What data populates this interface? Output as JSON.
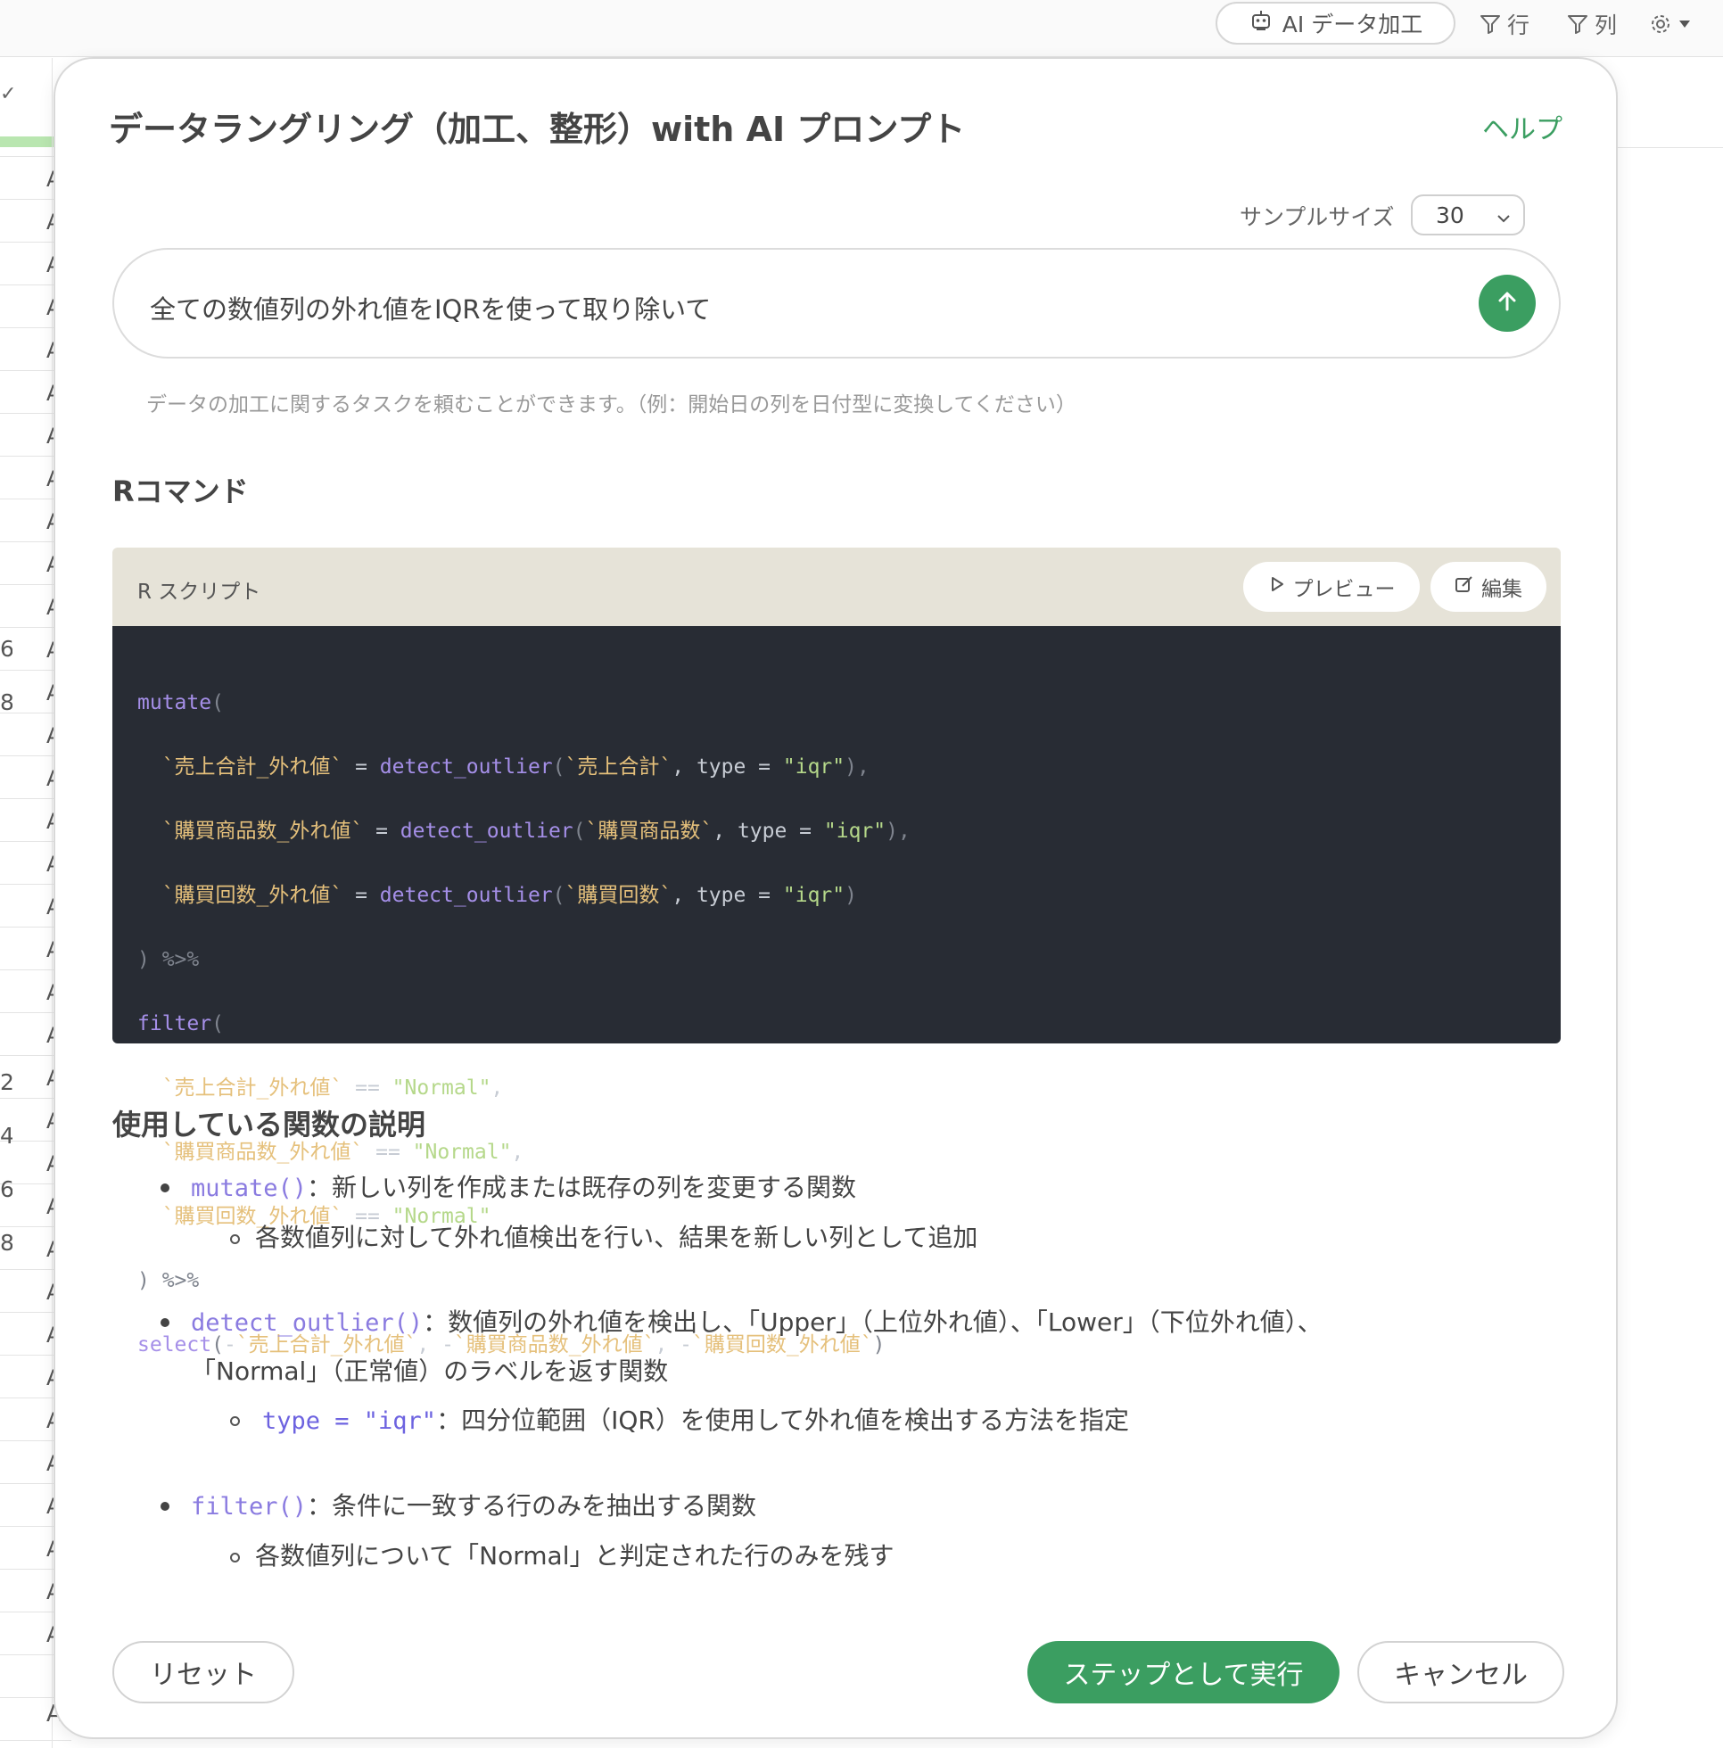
{
  "toolbar": {
    "ai_button": "AI データ加工",
    "row_filter": "行",
    "column_filter": "列"
  },
  "sheet": {
    "row_numbers": [
      "6",
      "8",
      "2",
      "4",
      "6",
      "8"
    ],
    "cell_text": "A",
    "bottom_cell": "A",
    "accent_color": "#b9e6b0"
  },
  "modal": {
    "title": "データラングリング（加工、整形）with AI プロンプト",
    "help_link": "ヘルプ",
    "sample_size_label": "サンプルサイズ",
    "sample_size_value": "30",
    "prompt_value": "全ての数値列の外れ値をIQRを使って取り除いて",
    "hint": "データの加工に関するタスクを頼むことができます。（例：開始日の列を日付型に変換してください）",
    "r_command_heading": "Rコマンド",
    "script_label": "R スクリプト",
    "preview_button": "プレビュー",
    "edit_button": "編集",
    "functions_heading": "使用している関数の説明",
    "reset_button": "リセット",
    "run_button": "ステップとして実行",
    "cancel_button": "キャンセル",
    "accent_color": "#3b9e61"
  },
  "code": {
    "l1": {
      "fn": "mutate",
      "open": "("
    },
    "l2": {
      "id1": "`売上合計_外れ値`",
      "eq": " = ",
      "fn": "detect_outlier",
      "open": "(",
      "id2": "`売上合計`",
      "comma": ", ",
      "kw": "type",
      "eq2": " = ",
      "str": "\"iqr\"",
      "close": "),"
    },
    "l3": {
      "id1": "`購買商品数_外れ値`",
      "eq": " = ",
      "fn": "detect_outlier",
      "open": "(",
      "id2": "`購買商品数`",
      "comma": ", ",
      "kw": "type",
      "eq2": " = ",
      "str": "\"iqr\"",
      "close": "),"
    },
    "l4": {
      "id1": "`購買回数_外れ値`",
      "eq": " = ",
      "fn": "detect_outlier",
      "open": "(",
      "id2": "`購買回数`",
      "comma": ", ",
      "kw": "type",
      "eq2": " = ",
      "str": "\"iqr\"",
      "close": ")"
    },
    "l5": {
      "text": ") %>%"
    },
    "l6": {
      "fn": "filter",
      "open": "("
    },
    "l7": {
      "id": "`売上合計_外れ値`",
      "op": " == ",
      "str": "\"Normal\"",
      "tail": ","
    },
    "l8": {
      "id": "`購買商品数_外れ値`",
      "op": " == ",
      "str": "\"Normal\"",
      "tail": ","
    },
    "l9": {
      "id": "`購買回数_外れ値`",
      "op": " == ",
      "str": "\"Normal\"",
      "tail": ""
    },
    "l10": {
      "text": ") %>%"
    },
    "l11": {
      "fn": "select",
      "open": "(",
      "m1": "-",
      "id1": "`売上合計_外れ値`",
      "c1": ", ",
      "m2": "-",
      "id2": "`購買商品数_外れ値`",
      "c2": ", ",
      "m3": "-",
      "id3": "`購買回数_外れ値`",
      "close": ")"
    }
  },
  "functions": {
    "mutate": {
      "name": "mutate()",
      "desc": "：新しい列を作成または既存の列を変更する関数",
      "sub": "各数値列に対して外れ値検出を行い、結果を新しい列として追加"
    },
    "detect": {
      "name": "detect_outlier()",
      "desc": "：数値列の外れ値を検出し、「Upper」（上位外れ値）、「Lower」（下位外れ値）、",
      "desc2": "「Normal」（正常値）のラベルを返す関数",
      "sub_code": "type = \"iqr\"",
      "sub": "：四分位範囲（IQR）を使用して外れ値を検出する方法を指定"
    },
    "filter": {
      "name": "filter()",
      "desc": "：条件に一致する行のみを抽出する関数",
      "sub": "各数値列について「Normal」と判定された行のみを残す"
    }
  }
}
